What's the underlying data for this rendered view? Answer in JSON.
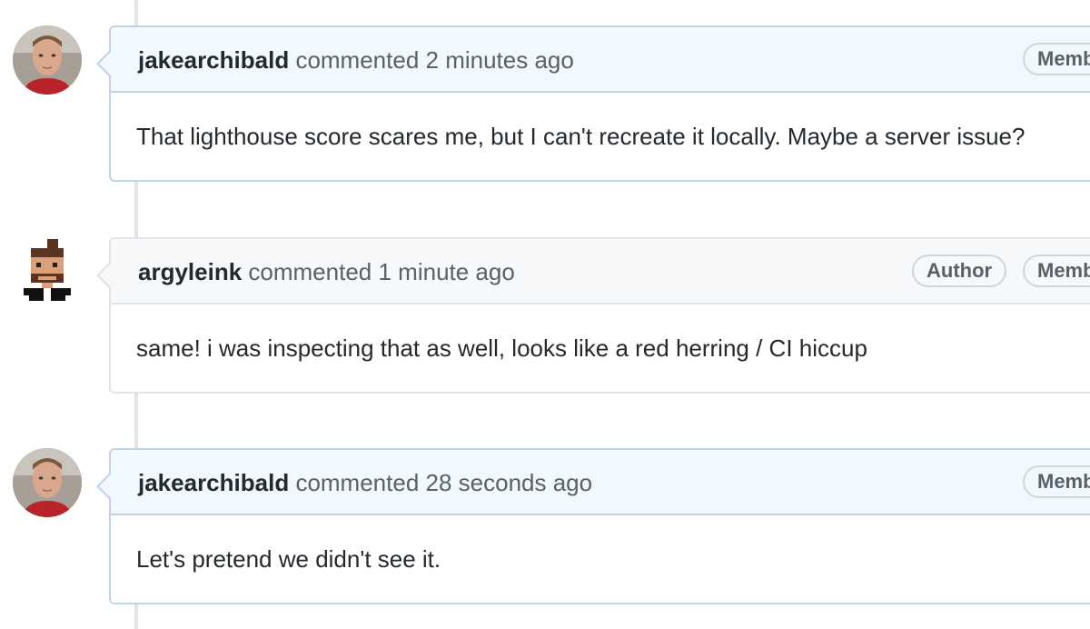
{
  "comments": [
    {
      "author": "jakearchibald",
      "action": "commented",
      "time": "2 minutes ago",
      "badges": [
        "Memb"
      ],
      "body": "That lighthouse score scares me, but I can't recreate it locally. Maybe a server issue?"
    },
    {
      "author": "argyleink",
      "action": "commented",
      "time": "1 minute ago",
      "badges": [
        "Author",
        "Memb"
      ],
      "body": "same! i was inspecting that as well, looks like a red herring / CI hiccup"
    },
    {
      "author": "jakearchibald",
      "action": "commented",
      "time": "28 seconds ago",
      "badges": [
        "Memb"
      ],
      "body": "Let's pretend we didn't see it."
    }
  ],
  "icons": {
    "avatar_1": "avatar-photo",
    "avatar_2": "pixel-avatar",
    "avatar_3": "avatar-photo"
  },
  "colors": {
    "member_header_bg": "#f1f8ff",
    "member_border": "#c0d3eb",
    "author_header_bg": "#f6f8fa",
    "author_border": "#e1e4e8"
  }
}
